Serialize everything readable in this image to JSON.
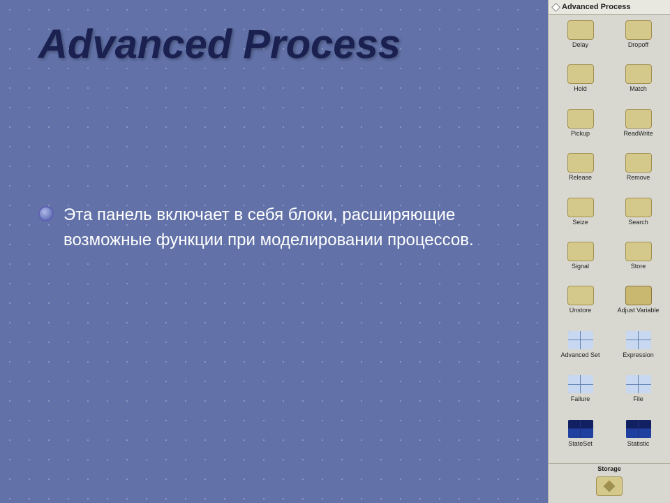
{
  "title": "Advanced Process",
  "panel": {
    "header": "Advanced Process",
    "items": [
      {
        "label": "Delay",
        "type": "tan"
      },
      {
        "label": "Dropoff",
        "type": "tan"
      },
      {
        "label": "Hold",
        "type": "tan"
      },
      {
        "label": "Match",
        "type": "tan"
      },
      {
        "label": "Pickup",
        "type": "tan"
      },
      {
        "label": "ReadWrite",
        "type": "tan"
      },
      {
        "label": "Release",
        "type": "tan"
      },
      {
        "label": "Remove",
        "type": "tan"
      },
      {
        "label": "Seize",
        "type": "tan"
      },
      {
        "label": "Search",
        "type": "tan"
      },
      {
        "label": "Signal",
        "type": "tan"
      },
      {
        "label": "Store",
        "type": "tan"
      },
      {
        "label": "Unstore",
        "type": "tan"
      },
      {
        "label": "Adjust\nVariable",
        "type": "tan"
      },
      {
        "label": "Advanced Set",
        "type": "table"
      },
      {
        "label": "Expression",
        "type": "table"
      },
      {
        "label": "Failure",
        "type": "table"
      },
      {
        "label": "File",
        "type": "table"
      },
      {
        "label": "StateSet",
        "type": "table-blue"
      },
      {
        "label": "Statistic",
        "type": "table-blue"
      }
    ],
    "storage": "Storage"
  },
  "bullet_text": "Эта панель включает в себя блоки, расширяющие возможные функции при моделировании процессов."
}
